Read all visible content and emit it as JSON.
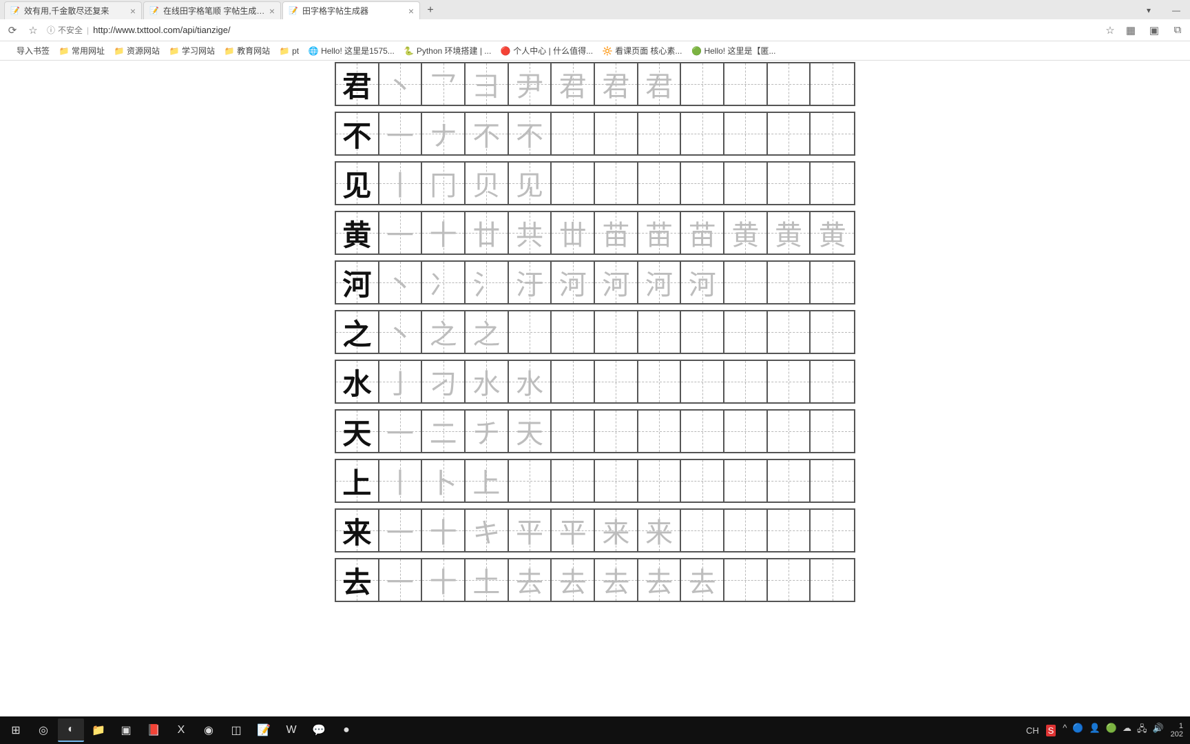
{
  "browser": {
    "tabs": [
      {
        "title": "效有用,千金散尽还复来",
        "favicon": "📝",
        "active": false
      },
      {
        "title": "在线田字格笔顺 字帖生成器 - ...",
        "favicon": "📝",
        "active": false
      },
      {
        "title": "田字格字帖生成器",
        "favicon": "📝",
        "active": true
      }
    ],
    "new_tab": "+",
    "win_min": "▾",
    "win_restore": "—",
    "win_close": "✕"
  },
  "addr": {
    "reload": "⟳",
    "star": "☆",
    "info_icon": "ⓘ",
    "insecure_label": "不安全",
    "sep": "|",
    "url": "http://www.txttool.com/api/tianzige/",
    "star_right": "☆"
  },
  "right_addr_icons": [
    "▦",
    "▣",
    "⧉"
  ],
  "bookmarks": [
    {
      "icon": "",
      "label": "导入书签",
      "cls": ""
    },
    {
      "icon": "📁",
      "label": "常用网址",
      "cls": "folder-ic"
    },
    {
      "icon": "📁",
      "label": "资源网站",
      "cls": "folder-ic"
    },
    {
      "icon": "📁",
      "label": "学习网站",
      "cls": "folder-ic"
    },
    {
      "icon": "📁",
      "label": "教育网站",
      "cls": "folder-ic"
    },
    {
      "icon": "📁",
      "label": "pt",
      "cls": "folder-ic"
    },
    {
      "icon": "🌐",
      "label": "Hello! 这里是1575...",
      "cls": ""
    },
    {
      "icon": "🐍",
      "label": "Python 环境搭建 | ...",
      "cls": ""
    },
    {
      "icon": "🔴",
      "label": "个人中心 | 什么值得...",
      "cls": ""
    },
    {
      "icon": "🔆",
      "label": "看课页面  核心素...",
      "cls": ""
    },
    {
      "icon": "🟢",
      "label": "Hello! 这里是【匿...",
      "cls": ""
    }
  ],
  "tianzige": {
    "cols": 12,
    "rows": [
      {
        "char": "君",
        "strokes": [
          "丶",
          "乛",
          "彐",
          "尹",
          "君",
          "君",
          "君",
          "",
          "",
          "",
          ""
        ]
      },
      {
        "char": "不",
        "strokes": [
          "一",
          "ナ",
          "不",
          "不",
          "",
          "",
          "",
          "",
          "",
          "",
          ""
        ]
      },
      {
        "char": "见",
        "strokes": [
          "丨",
          "冂",
          "贝",
          "见",
          "",
          "",
          "",
          "",
          "",
          "",
          ""
        ]
      },
      {
        "char": "黄",
        "strokes": [
          "一",
          "十",
          "廿",
          "共",
          "丗",
          "苗",
          "苗",
          "苗",
          "黄",
          "黄",
          "黄"
        ]
      },
      {
        "char": "河",
        "strokes": [
          "丶",
          "冫",
          "氵",
          "汙",
          "河",
          "河",
          "河",
          "河",
          "",
          "",
          ""
        ]
      },
      {
        "char": "之",
        "strokes": [
          "丶",
          "之",
          "之",
          "",
          "",
          "",
          "",
          "",
          "",
          "",
          ""
        ]
      },
      {
        "char": "水",
        "strokes": [
          "亅",
          "刁",
          "水",
          "水",
          "",
          "",
          "",
          "",
          "",
          "",
          ""
        ]
      },
      {
        "char": "天",
        "strokes": [
          "一",
          "二",
          "チ",
          "天",
          "",
          "",
          "",
          "",
          "",
          "",
          ""
        ]
      },
      {
        "char": "上",
        "strokes": [
          "丨",
          "卜",
          "上",
          "",
          "",
          "",
          "",
          "",
          "",
          "",
          ""
        ]
      },
      {
        "char": "来",
        "strokes": [
          "一",
          "十",
          "キ",
          "平",
          "平",
          "来",
          "来",
          "",
          "",
          "",
          ""
        ]
      },
      {
        "char": "去",
        "strokes": [
          "一",
          "十",
          "土",
          "去",
          "去",
          "去",
          "去",
          "去",
          "",
          "",
          ""
        ]
      }
    ]
  },
  "taskbar": {
    "items": [
      "⊞",
      "◎",
      "◐",
      "📁",
      "▣",
      "📕",
      "X",
      "◉",
      "◫",
      "📝",
      "W",
      "💬",
      "●"
    ],
    "active": [
      false,
      false,
      true,
      false,
      false,
      false,
      false,
      false,
      false,
      false,
      false,
      false,
      false
    ],
    "tray_ime": "CH",
    "tray_sogou": "S",
    "tray_icons": [
      "^",
      "🔵",
      "👤",
      "🟢",
      "☁",
      "🖧",
      "🔊"
    ],
    "time": "1",
    "date": "202"
  }
}
